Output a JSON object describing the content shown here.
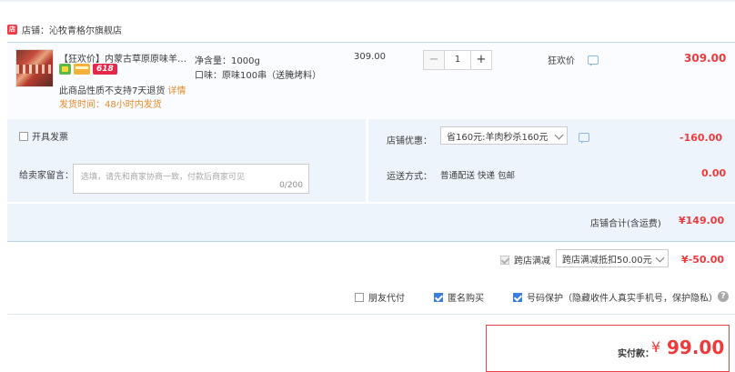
{
  "shop": {
    "prefix": "店铺：",
    "name": "沁牧青格尔旗舰店",
    "icon": "shop-icon"
  },
  "item": {
    "title": "【狂欢价】内蒙古草原原味羊肉...",
    "badge_618": "618",
    "spec_weight": "净含量：1000g",
    "spec_flavor": "口味：原味100串（送腌烤料）",
    "return_note": "此商品性质不支持7天退货",
    "return_detail": "详情",
    "ship_time": "发货时间：48小时内发货",
    "unit_price": "309.00",
    "quantity": "1",
    "qty_minus": "−",
    "qty_plus": "+",
    "promo": "狂欢价",
    "total": "309.00"
  },
  "invoice": {
    "label": "开具发票",
    "checked": false
  },
  "message": {
    "label": "给卖家留言：",
    "placeholder": "选填，请先和商家协商一致，付款后商家可见",
    "count": "0/200"
  },
  "discount": {
    "label": "店铺优惠：",
    "selected": "省160元:羊肉秒杀160元",
    "value": "-160.00"
  },
  "shipping": {
    "label": "运送方式：",
    "method": "普通配送 快递 包邮",
    "value": "0.00"
  },
  "subtotal": {
    "label": "店铺合计(含运费)",
    "value": "¥149.00"
  },
  "cross_store": {
    "label": "跨店满减",
    "selected": "跨店满减抵扣50.00元",
    "value": "¥-50.00",
    "checked": true
  },
  "options": {
    "friend_pay": {
      "label": "朋友代付",
      "checked": false
    },
    "anonymous": {
      "label": "匿名购买",
      "checked": true
    },
    "phone_protect": {
      "label": "号码保护（隐藏收件人真实手机号，保护隐私）",
      "checked": true
    },
    "help": "?"
  },
  "payment": {
    "label": "实付款：",
    "currency": "¥",
    "amount": "99.00"
  },
  "colors": {
    "price_red": "#ee3a3a",
    "accent_blue": "#3b7ee0",
    "panel_bg": "#eef4fc",
    "orange": "#e88a2b"
  }
}
